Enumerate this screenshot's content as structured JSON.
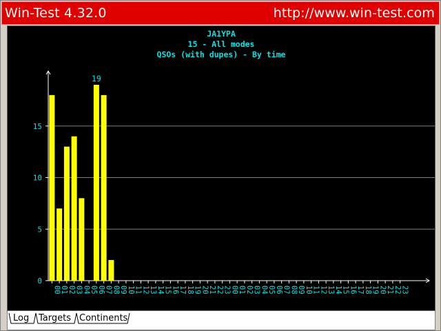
{
  "window": {
    "title": "Win-Test 4.32.0",
    "url": "http://www.win-test.com"
  },
  "colors": {
    "titlebar": "#e00000",
    "chart_background": "#000000",
    "bar": "#ffff00",
    "text": "#00e5e5",
    "grid": "#808080",
    "axis": "#ffffff"
  },
  "tabs": [
    {
      "label": "Log"
    },
    {
      "label": "Targets"
    },
    {
      "label": "Continents"
    }
  ],
  "chart_data": {
    "type": "bar",
    "title_lines": [
      "JA1YPA",
      "15 - All modes",
      "QSOs (with dupes) - By time"
    ],
    "categories": [
      "00",
      "01",
      "02",
      "03",
      "04",
      "05",
      "06",
      "07",
      "08",
      "09",
      "10",
      "11",
      "12",
      "13",
      "14",
      "15",
      "16",
      "17",
      "18",
      "19",
      "20",
      "21",
      "22",
      "23",
      "00",
      "01",
      "02",
      "03",
      "04",
      "05",
      "06",
      "07",
      "08",
      "09",
      "10",
      "11",
      "12",
      "13",
      "14",
      "15",
      "16",
      "17",
      "18",
      "19",
      "20",
      "21",
      "22",
      "23"
    ],
    "values": [
      18,
      7,
      13,
      14,
      8,
      0,
      19,
      18,
      2,
      0,
      0,
      0,
      0,
      0,
      0,
      0,
      0,
      0,
      0,
      0,
      0,
      0,
      0,
      0,
      0,
      0,
      0,
      0,
      0,
      0,
      0,
      0,
      0,
      0,
      0,
      0,
      0,
      0,
      0,
      0,
      0,
      0,
      0,
      0,
      0,
      0,
      0,
      0
    ],
    "max_label": "19",
    "yticks": [
      "0",
      "5",
      "10",
      "15"
    ],
    "ylim": [
      0,
      20
    ],
    "grid": true
  }
}
